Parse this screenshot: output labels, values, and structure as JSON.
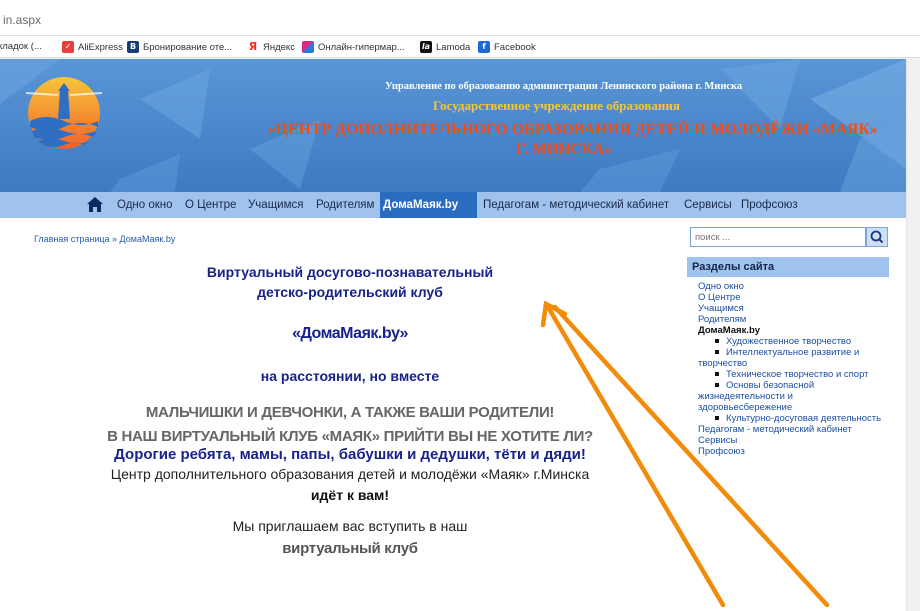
{
  "browser": {
    "url": "in.aspx",
    "bookmarks": [
      {
        "icon": "bookmarks-folder-icon",
        "label": "кладок (..."
      },
      {
        "icon": "aliexpress-icon",
        "label": "AliExpress",
        "color": "#e8403a"
      },
      {
        "icon": "booking-icon",
        "label": "Бронирование оте...",
        "color": "#183c7a"
      },
      {
        "icon": "yandex-icon",
        "label": "Яндекс",
        "color": "#ff2a1a"
      },
      {
        "icon": "online-store-icon",
        "label": "Онлайн-гипермар...",
        "color": "#d82a8a"
      },
      {
        "icon": "lamoda-icon",
        "label": "Lamoda",
        "color": "#111111"
      },
      {
        "icon": "facebook-icon",
        "label": "Facebook",
        "color": "#1b6ad8"
      }
    ]
  },
  "header": {
    "line1": "Управление по образованию администрации Ленинского района г. Минска",
    "line2": "Государственное учреждение образования",
    "line3": "«ЦЕНТР ДОПОЛНИТЕЛЬНОГО ОБРАЗОВАНИЯ ДЕТЕЙ И МОЛОДЁЖИ «МАЯК»",
    "line4": "Г. МИНСКА»"
  },
  "nav": {
    "home_icon": "home-icon",
    "items": [
      {
        "label": "Одно окно",
        "active": false
      },
      {
        "label": "О Центре",
        "active": false
      },
      {
        "label": "Учащимся",
        "active": false
      },
      {
        "label": "Родителям",
        "active": false
      },
      {
        "label": "ДомаМаяк.by",
        "active": true
      },
      {
        "label": "Педагогам - методический кабинет",
        "active": false
      },
      {
        "label": "Сервисы",
        "active": false
      },
      {
        "label": "Профсоюз",
        "active": false
      }
    ]
  },
  "breadcrumb": "Главная страница » ДомаМаяк.by",
  "main": {
    "title_line1": "Виртуальный досугово-познавательный",
    "title_line2": "детско-родительский клуб",
    "club_name": "«ДомаМаяк.by»",
    "motto": "на расстоянии, но вместе",
    "slogan_line1": "МАЛЬЧИШКИ И ДЕВЧОНКИ, А ТАКЖЕ ВАШИ РОДИТЕЛИ!",
    "slogan_line2": "В НАШ ВИРТУАЛЬНЫЙ КЛУБ «МАЯК» ПРИЙТИ ВЫ НЕ ХОТИТЕ ЛИ?",
    "greeting": "Дорогие ребята, мамы, папы, бабушки и дедушки, тёти и дяди!",
    "center_line": "Центр дополнительного образования детей и молодёжи «Маяк» г.Минска",
    "coming": "идёт к вам!",
    "invite": "Мы приглашаем вас вступить в наш",
    "virtual_club": "виртуальный клуб"
  },
  "sidebar": {
    "search_placeholder": "поиск ...",
    "search_icon": "search-icon",
    "section_title": "Разделы сайта",
    "links": [
      {
        "label": "Одно окно"
      },
      {
        "label": "О Центре"
      },
      {
        "label": "Учащимся"
      },
      {
        "label": "Родителям"
      },
      {
        "label": "ДомаМаяк.by",
        "bold": true
      },
      {
        "label": "Художественное творчество",
        "sub": true
      },
      {
        "label": "Интеллектуальное развитие и творчество",
        "sub": true
      },
      {
        "label": "Техническое творчество и спорт",
        "sub": true
      },
      {
        "label": "Основы безопасной жизнедеятельности и здоровьесбережение",
        "sub": true
      },
      {
        "label": "Культурно-досуговая деятельность",
        "sub": true
      },
      {
        "label": "Педагогам - методический кабинет"
      },
      {
        "label": "Сервисы"
      },
      {
        "label": "Профсоюз"
      }
    ]
  },
  "colors": {
    "banner": "#4a86cd",
    "nav": "#9fc3ec",
    "nav_active": "#2a6cc0",
    "title_blue": "#17228a",
    "header_orange": "#f24b1a",
    "header_yellow": "#f7c633",
    "annotation_arrow": "#f28a0a"
  }
}
